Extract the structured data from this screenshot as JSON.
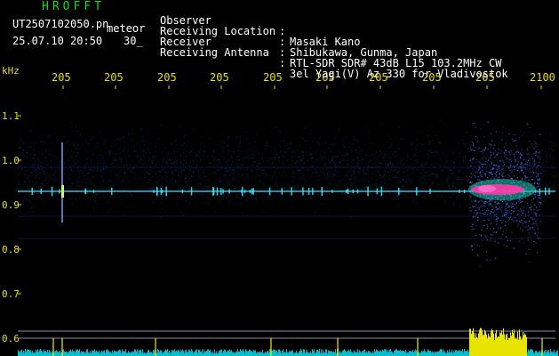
{
  "header": {
    "title": "HROFFT",
    "filename": "UT2507102050.pn",
    "type_label": "meteor",
    "datetime": "25.07.10 20:50",
    "duration": "30_"
  },
  "station_info": [
    {
      "label": "Observer",
      "value": "Masaki Kano"
    },
    {
      "label": "Receiving Location",
      "value": "Shibukawa, Gunma, Japan"
    },
    {
      "label": "Receiver",
      "value": "RTL-SDR SDR# 43dB L15 103.2MHz CW"
    },
    {
      "label": "Receiving Antenna",
      "value": "3el Yagi(V) Az 330 for Vladivostok"
    }
  ],
  "axis": {
    "y_unit": "kHz",
    "y_ticks": [
      "1.1",
      "1.0",
      "0.9",
      "0.8",
      "0.7",
      "0.6"
    ],
    "x_ticks": [
      "205",
      "205",
      "205",
      "205",
      "205",
      "205",
      "205",
      "205",
      "205",
      "2100"
    ]
  },
  "colors": {
    "background": "#000000",
    "text_white": "#ffffff",
    "text_green": "#1fd41f",
    "tick_yellow": "#e8e000",
    "noise_blue": "#1a3aa8",
    "carrier_cyan": "#39e0ff",
    "echo_magenta": "#ff3aa8",
    "level_yellow": "#f4f000",
    "level_cyan": "#00c8d8"
  }
}
